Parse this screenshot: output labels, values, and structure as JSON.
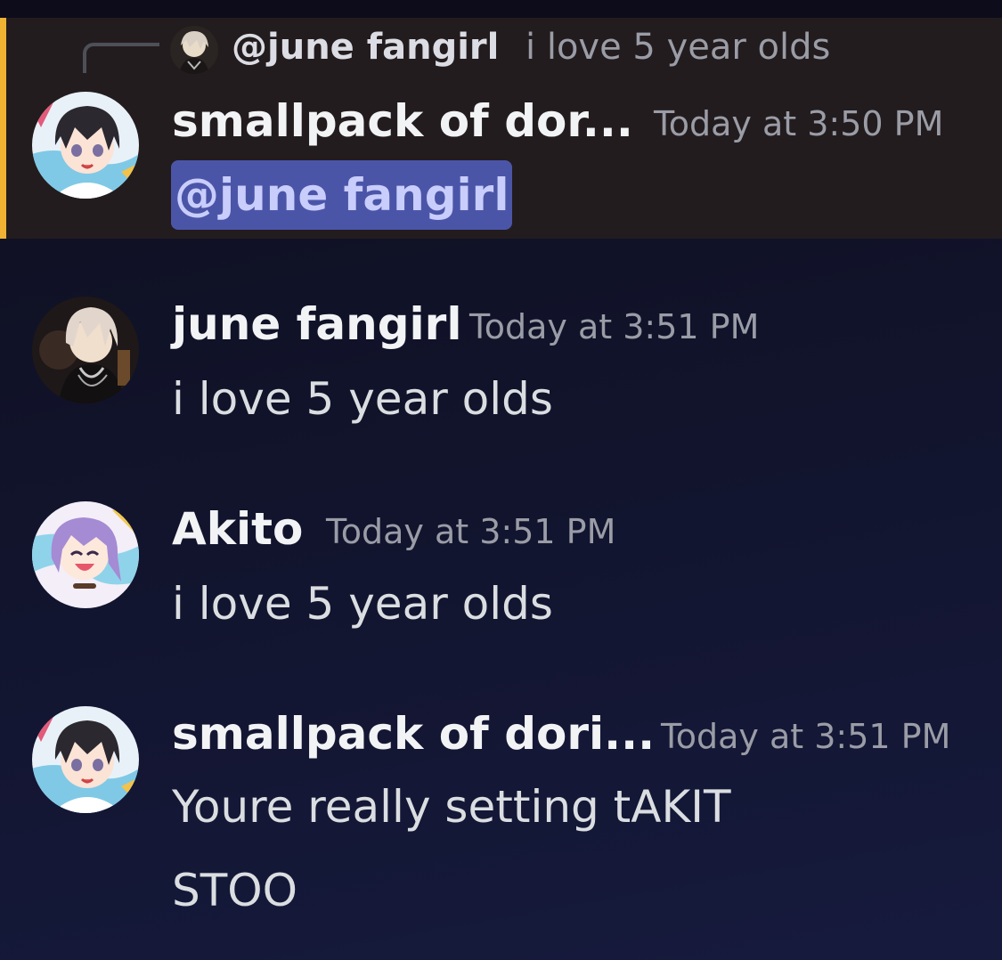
{
  "colors": {
    "mention_bar": "#f0b232",
    "mention_highlight": "#231c1e",
    "mention_pill": "#4b55a8",
    "mention_text": "#c9cdfb",
    "timestamp": "#9a9ca6"
  },
  "messages": [
    {
      "reply": {
        "author": "@june fangirl",
        "text": "i love 5 year olds",
        "avatar_icon": "june-fangirl-avatar"
      },
      "author": "smallpack of dor...",
      "timestamp": "Today at 3:50 PM",
      "mention": "@june fangirl",
      "avatar_icon": "smallpack-avatar",
      "highlighted": true
    },
    {
      "author": "june fangirl",
      "timestamp": "Today at 3:51 PM",
      "lines": [
        "i love 5 year olds"
      ],
      "avatar_icon": "june-fangirl-avatar"
    },
    {
      "author": "Akito",
      "timestamp": "Today at 3:51 PM",
      "lines": [
        "i love 5 year olds"
      ],
      "avatar_icon": "akito-avatar"
    },
    {
      "author": "smallpack of dori...",
      "timestamp": "Today at 3:51 PM",
      "lines": [
        "Youre really setting tAKIT",
        "STOO"
      ],
      "avatar_icon": "smallpack-avatar"
    }
  ]
}
